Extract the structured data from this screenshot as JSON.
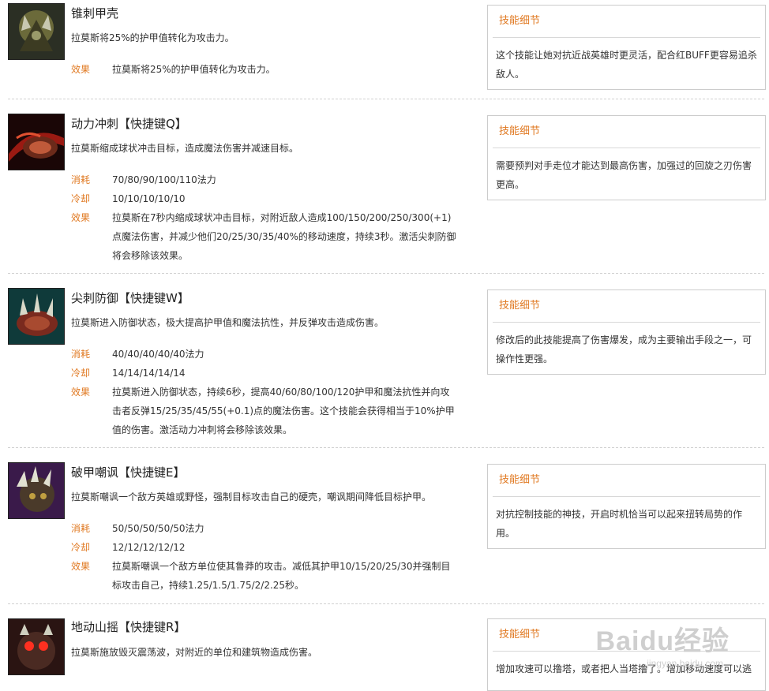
{
  "labels": {
    "cost": "消耗",
    "cooldown": "冷却",
    "effect": "效果",
    "detail": "技能细节"
  },
  "skills": [
    {
      "name": "锥刺甲壳",
      "desc": "拉莫斯将25%的护甲值转化为攻击力。",
      "effect": "拉莫斯将25%的护甲值转化为攻击力。",
      "detail": "这个技能让她对抗近战英雄时更灵活，配合红BUFF更容易追杀敌人。",
      "icon": "armordillo-passive-icon"
    },
    {
      "name": "动力冲刺【快捷键Q】",
      "desc": "拉莫斯缩成球状冲击目标，造成魔法伤害并减速目标。",
      "cost": "70/80/90/100/110法力",
      "cooldown": "10/10/10/10/10",
      "effect": "拉莫斯在7秒内缩成球状冲击目标，对附近敌人造成100/150/200/250/300(+1)点魔法伤害，并减少他们20/25/30/35/40%的移动速度，持续3秒。激活尖刺防御将会移除该效果。",
      "detail": "需要预判对手走位才能达到最高伤害，加强过的回旋之刃伤害更高。",
      "icon": "powerball-icon"
    },
    {
      "name": "尖刺防御【快捷键W】",
      "desc": "拉莫斯进入防御状态，极大提高护甲值和魔法抗性，并反弹攻击造成伤害。",
      "cost": "40/40/40/40/40法力",
      "cooldown": "14/14/14/14/14",
      "effect": "拉莫斯进入防御状态，持续6秒，提高40/60/80/100/120护甲和魔法抗性并向攻击者反弹15/25/35/45/55(+0.1)点的魔法伤害。这个技能会获得相当于10%护甲值的伤害。激活动力冲刺将会移除该效果。",
      "detail": "修改后的此技能提高了伤害爆发，成为主要输出手段之一，可操作性更强。",
      "icon": "defensive-ball-curl-icon"
    },
    {
      "name": "破甲嘲讽【快捷键E】",
      "desc": "拉莫斯嘲讽一个敌方英雄或野怪，强制目标攻击自己的硬壳，嘲讽期间降低目标护甲。",
      "cost": "50/50/50/50/50法力",
      "cooldown": "12/12/12/12/12",
      "effect": "拉莫斯嘲讽一个敌方单位使其鲁莽的攻击。减低其护甲10/15/20/25/30并强制目标攻击自己，持续1.25/1.5/1.75/2/2.25秒。",
      "detail": "对抗控制技能的神技，开启时机恰当可以起来扭转局势的作用。",
      "icon": "puncturing-taunt-icon"
    },
    {
      "name": "地动山摇【快捷键R】",
      "desc": "拉莫斯施放毁灭震荡波，对附近的单位和建筑物造成伤害。",
      "detail": "增加攻速可以撸塔，或者把人当塔撸了。增加移动速度可以逃",
      "icon": "tremors-icon"
    }
  ],
  "watermark": {
    "brand": "Baidu经验",
    "url": "jingyan.baidu.com"
  }
}
